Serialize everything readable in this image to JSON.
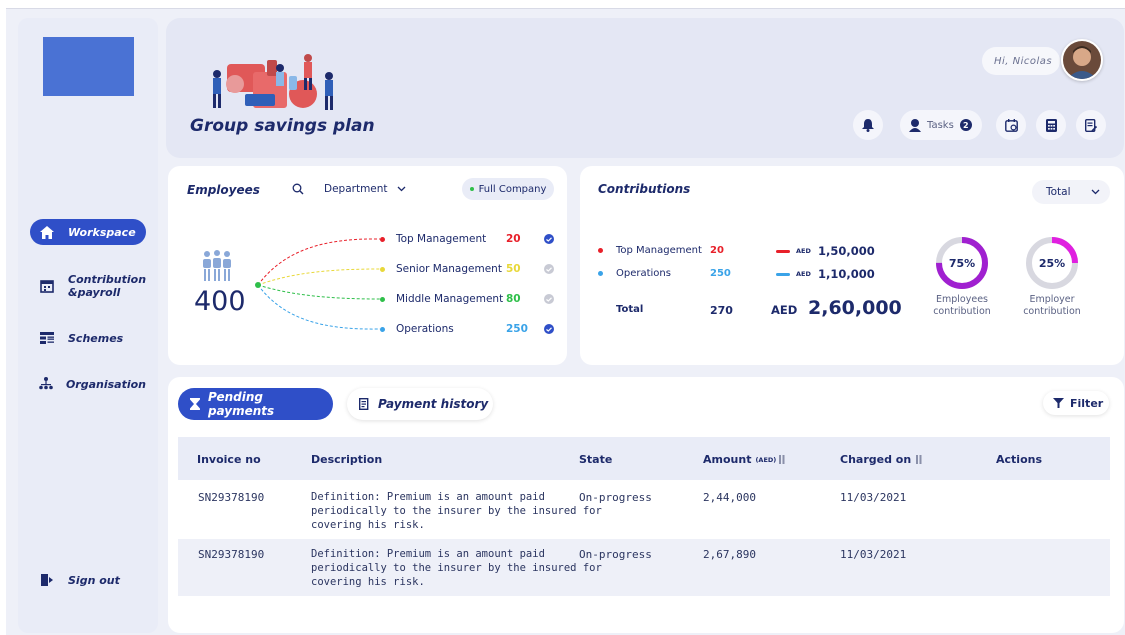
{
  "app": {
    "title": "Group savings plan",
    "greeting": "Hi, Nicolas"
  },
  "colors": {
    "primary": "#2f4fc8",
    "navy": "#1d2a6b",
    "red": "#e8202a",
    "blue": "#3aa3e8",
    "yellow": "#e8d83a",
    "green": "#2fbf4a",
    "purple": "#a020d0",
    "magenta": "#e020e0"
  },
  "sidebar": {
    "items": [
      {
        "label": "Workspace",
        "icon": "home-icon",
        "active": true
      },
      {
        "label": "Contribution &payroll",
        "icon": "calendar-icon",
        "active": false
      },
      {
        "label": "Schemes",
        "icon": "schemes-icon",
        "active": false
      },
      {
        "label": "Organisation",
        "icon": "org-chart-icon",
        "active": false
      }
    ],
    "signout": {
      "label": "Sign out",
      "icon": "sign-out-icon"
    }
  },
  "header": {
    "tasks_label": "Tasks",
    "tasks_count": "2",
    "icons": [
      "bell-icon",
      "calendar-icon",
      "calculator-icon",
      "document-icon"
    ]
  },
  "employees": {
    "title": "Employees",
    "filter_label": "Department",
    "scope_label": "Full Company",
    "total": "400",
    "groups": [
      {
        "label": "Top Management",
        "value": "20",
        "dot_color": "#e8202a",
        "value_color": "#e8202a",
        "checked": true
      },
      {
        "label": "Senior Management",
        "value": "50",
        "dot_color": "#e8d83a",
        "value_color": "#e8d83a",
        "checked": false
      },
      {
        "label": "Middle Management",
        "value": "80",
        "dot_color": "#2fbf4a",
        "value_color": "#2fbf4a",
        "checked": false
      },
      {
        "label": "Operations",
        "value": "250",
        "dot_color": "#3aa3e8",
        "value_color": "#3aa3e8",
        "checked": true
      }
    ]
  },
  "contributions": {
    "title": "Contributions",
    "select_label": "Total",
    "rows": [
      {
        "label": "Top Management",
        "count": "20",
        "currency": "AED",
        "amount": "1,50,000",
        "color": "#e8202a"
      },
      {
        "label": "Operations",
        "count": "250",
        "currency": "AED",
        "amount": "1,10,000",
        "color": "#3aa3e8"
      }
    ],
    "total_label": "Total",
    "total_count": "270",
    "total_currency": "AED",
    "total_amount": "2,60,000",
    "donuts": [
      {
        "percent": 75,
        "display": "75%",
        "label": "Employees contribution",
        "color": "#a020d0"
      },
      {
        "percent": 25,
        "display": "25%",
        "label": "Employer contribution",
        "color": "#e020e0"
      }
    ]
  },
  "payments": {
    "tabs": [
      {
        "label": "Pending payments",
        "active": true
      },
      {
        "label": "Payment history",
        "active": false
      }
    ],
    "filter_label": "Filter",
    "columns": {
      "invoice": "Invoice no",
      "description": "Description",
      "state": "State",
      "amount": "Amount",
      "amount_unit": "(AED)",
      "charged": "Charged on",
      "actions": "Actions"
    },
    "rows": [
      {
        "invoice": "SN29378190",
        "description_lines": [
          "Definition: Premium is an amount paid",
          "periodically to the insurer by the insured for",
          "covering his risk."
        ],
        "state": "On-progress",
        "amount": "2,44,000",
        "charged": "11/03/2021"
      },
      {
        "invoice": "SN29378190",
        "description_lines": [
          "Definition: Premium is an amount paid",
          "periodically to the insurer by the insured for",
          "covering his risk."
        ],
        "state": "On-progress",
        "amount": "2,67,890",
        "charged": "11/03/2021"
      }
    ]
  }
}
